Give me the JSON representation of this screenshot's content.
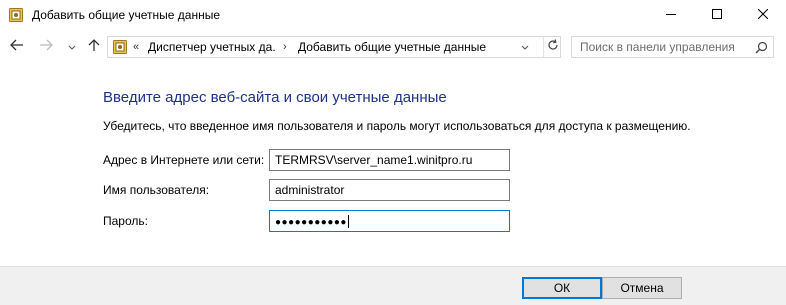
{
  "window": {
    "title": "Добавить общие учетные данные",
    "title_icon": "credential-manager-icon"
  },
  "window_controls": {
    "minimize_icon": "minimize-icon",
    "maximize_icon": "maximize-icon",
    "close_icon": "close-icon"
  },
  "navigation": {
    "back_icon": "arrow-left-icon",
    "forward_icon": "arrow-right-icon",
    "recent_icon": "chevron-down-icon",
    "up_icon": "arrow-up-icon"
  },
  "address_bar": {
    "overflow_chevron": "«",
    "crumbs": [
      "Диспетчер учетных да...",
      "Добавить общие учетные данные"
    ],
    "separator": "›",
    "dropdown_icon": "chevron-down-icon",
    "refresh_icon": "refresh-icon"
  },
  "search": {
    "placeholder": "Поиск в панели управления",
    "icon": "search-icon"
  },
  "content": {
    "heading": "Введите адрес веб-сайта и свои учетные данные",
    "description": "Убедитесь, что введенное имя пользователя и пароль могут использоваться для доступа к размещению.",
    "fields": [
      {
        "label": "Адрес в Интернете или сети:",
        "value": "TERMRSV\\server_name1.winitpro.ru"
      },
      {
        "label": "Имя пользователя:",
        "value": "administrator"
      },
      {
        "label": "Пароль:",
        "value": "●●●●●●●●●●●"
      }
    ]
  },
  "buttons": {
    "ok_label": "ОК",
    "cancel_label": "Отмена"
  },
  "colors": {
    "heading": "#1e3287",
    "focus_border": "#0078d7",
    "footer_bg": "#f0f0f0"
  }
}
